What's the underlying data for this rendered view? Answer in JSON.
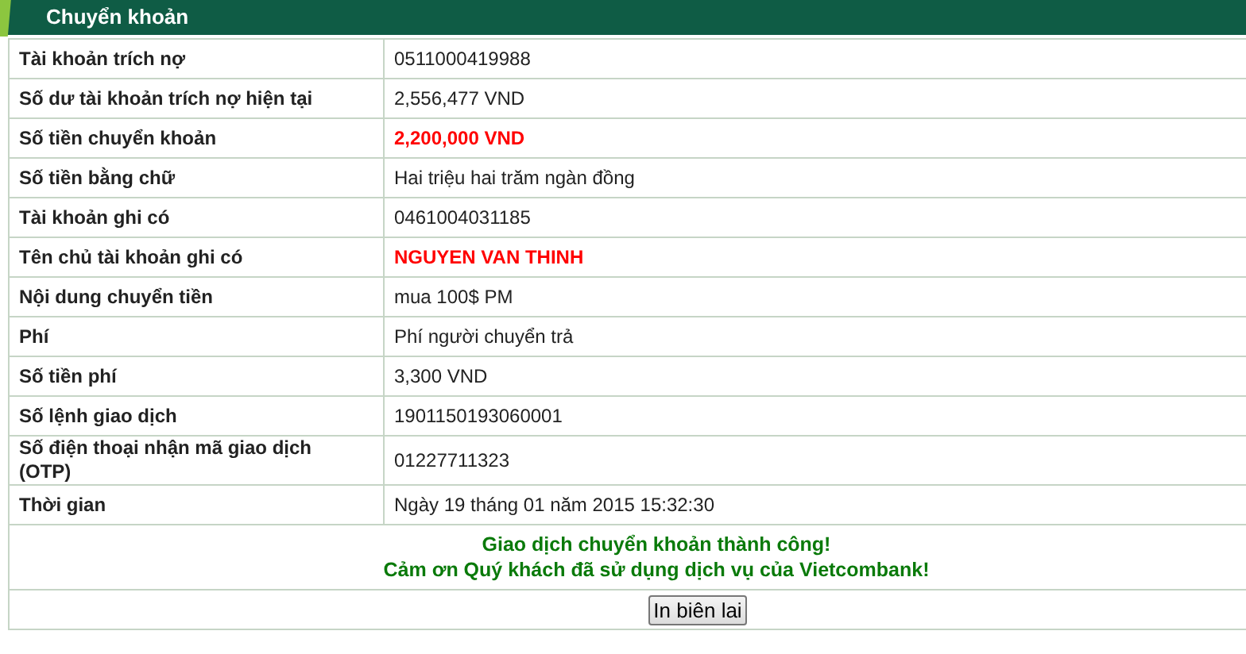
{
  "header": {
    "title": "Chuyển khoản"
  },
  "rows": [
    {
      "label": "Tài khoản trích nợ",
      "value": "0511000419988",
      "highlight": false
    },
    {
      "label": "Số dư tài khoản trích nợ hiện tại",
      "value": "2,556,477 VND",
      "highlight": false
    },
    {
      "label": "Số tiền chuyển khoản",
      "value": "2,200,000 VND",
      "highlight": true
    },
    {
      "label": "Số tiền bằng chữ",
      "value": "Hai triệu hai trăm ngàn đồng",
      "highlight": false
    },
    {
      "label": "Tài khoản ghi có",
      "value": "0461004031185",
      "highlight": false
    },
    {
      "label": "Tên chủ tài khoản ghi có",
      "value": "NGUYEN VAN THINH",
      "highlight": true
    },
    {
      "label": "Nội dung chuyển tiền",
      "value": "mua 100$ PM",
      "highlight": false
    },
    {
      "label": "Phí",
      "value": "Phí người chuyển trả",
      "highlight": false
    },
    {
      "label": "Số tiền phí",
      "value": "3,300 VND",
      "highlight": false
    },
    {
      "label": "Số lệnh giao dịch",
      "value": "1901150193060001",
      "highlight": false
    },
    {
      "label": "Số điện thoại nhận mã giao dịch (OTP)",
      "value": "01227711323",
      "highlight": false
    },
    {
      "label": "Thời gian",
      "value": "Ngày 19 tháng 01 năm 2015 15:32:30",
      "highlight": false
    }
  ],
  "message": [
    "Giao dịch chuyển khoản thành công!",
    "Cảm ơn Quý khách đã sử dụng dịch vụ của Vietcombank!"
  ],
  "print_button": "In biên lai"
}
